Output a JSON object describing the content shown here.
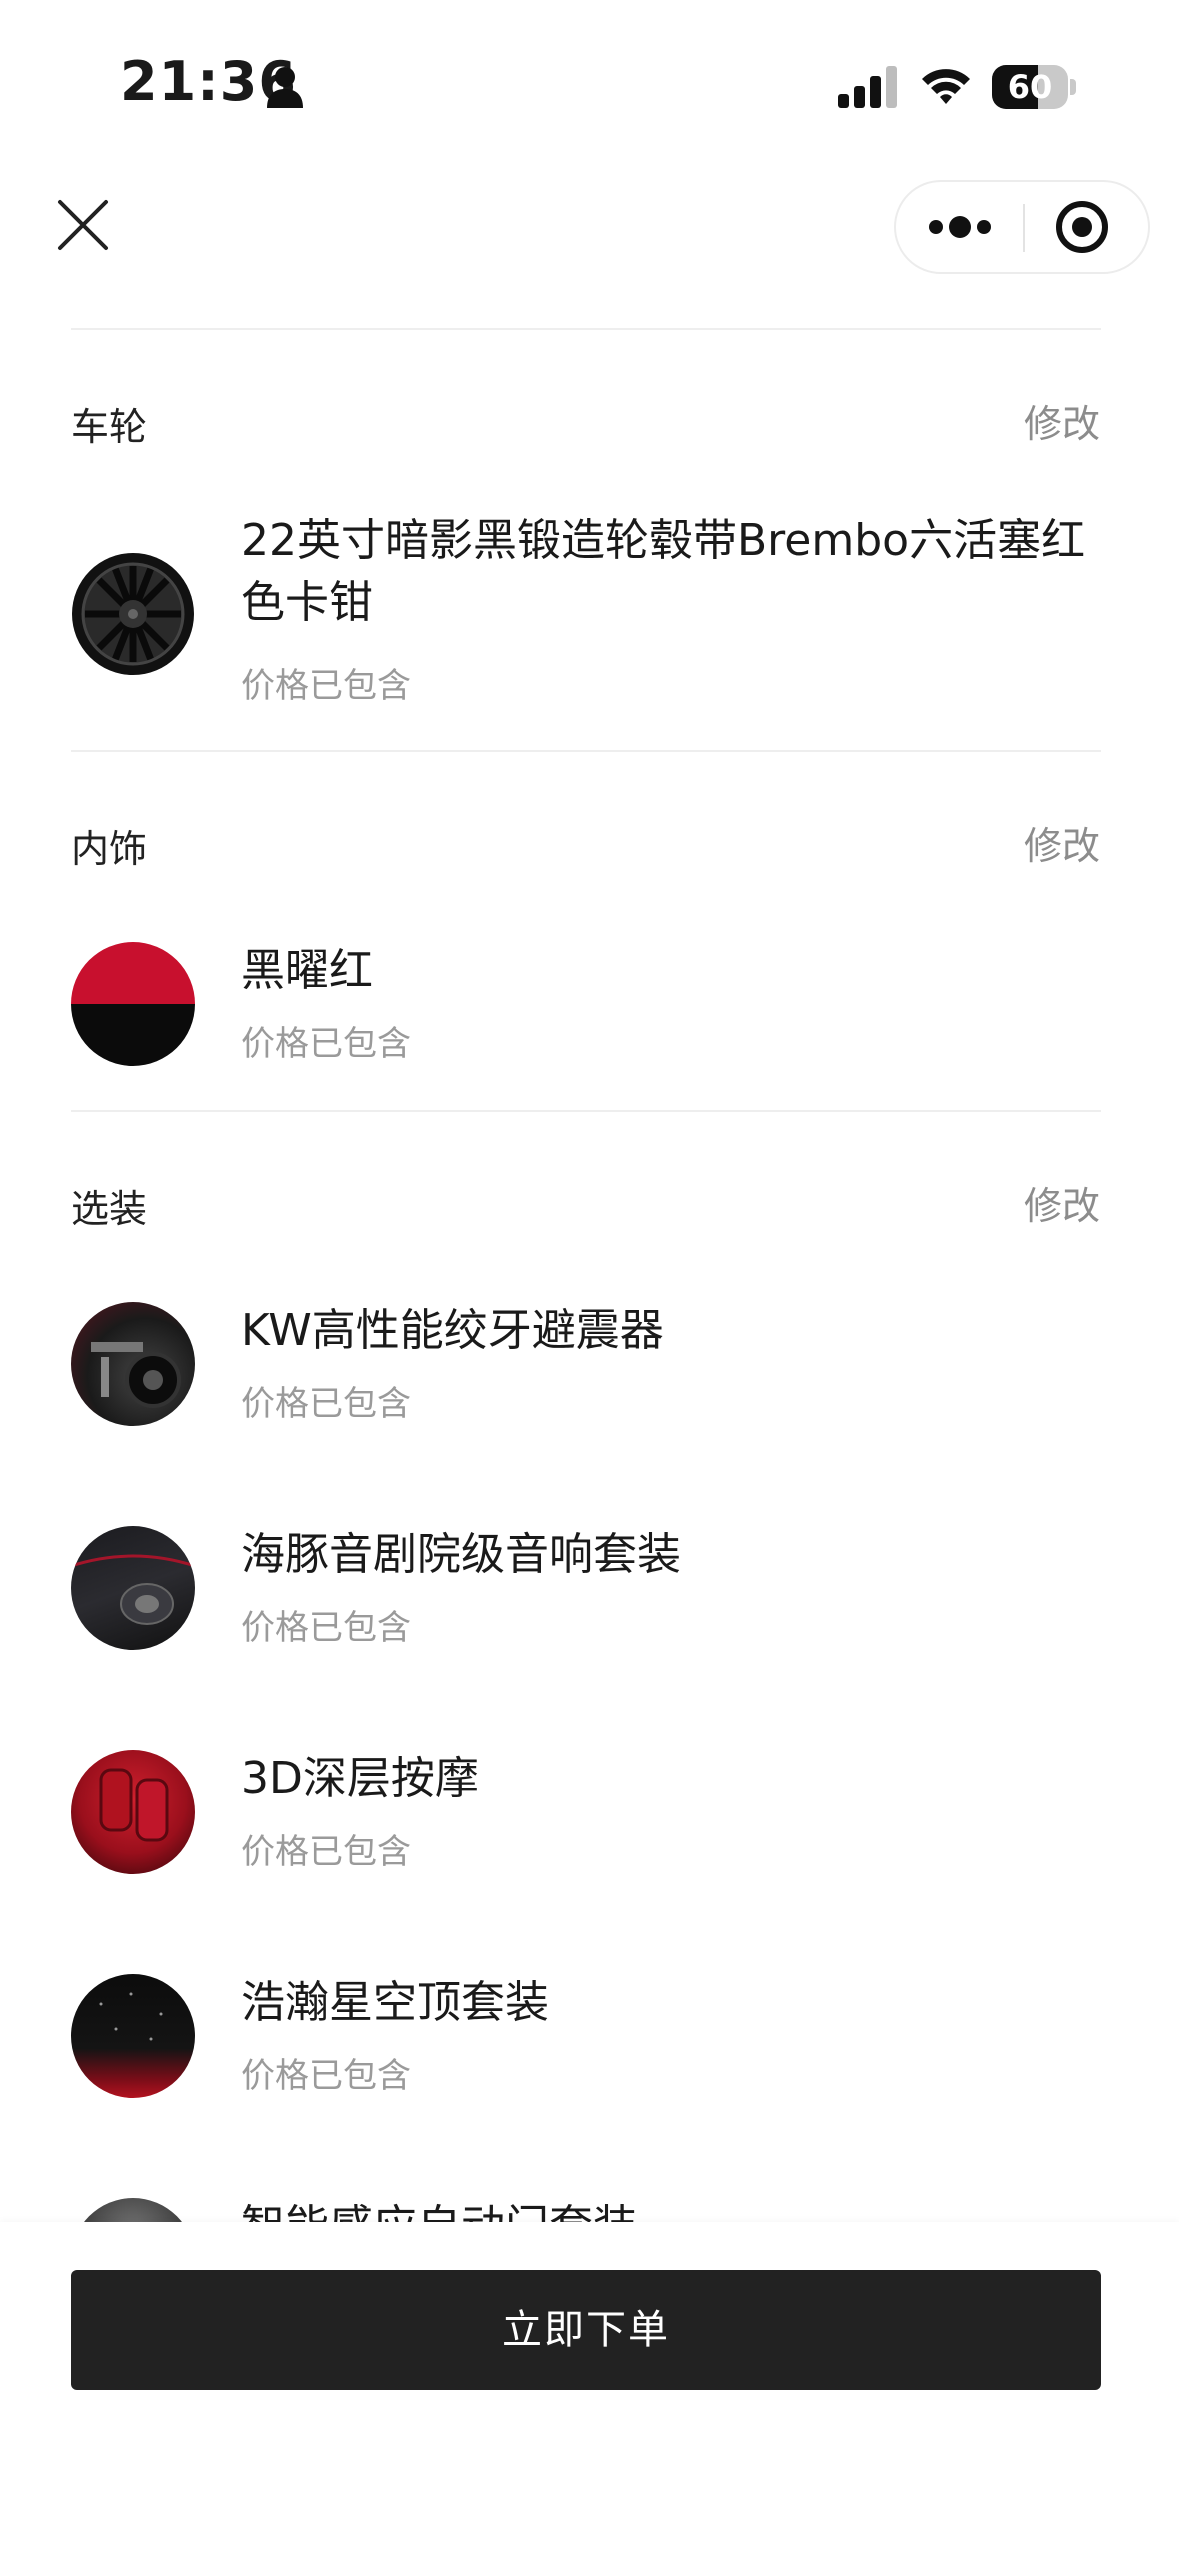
{
  "status_bar": {
    "time": "21:36",
    "battery": "60",
    "battery_level": 0.6
  },
  "nav": {
    "icons": [
      "close-icon",
      "more-dots-icon",
      "target-icon"
    ]
  },
  "sections": {
    "wheels": {
      "title": "车轮",
      "edit": "修改",
      "item": {
        "name": "22英寸暗影黑锻造轮毂带Brembo六活塞红色卡钳",
        "note": "价格已包含"
      }
    },
    "interior": {
      "title": "内饰",
      "edit": "修改",
      "item": {
        "name": "黑曜红",
        "note": "价格已包含"
      }
    },
    "options": {
      "title": "选装",
      "edit": "修改",
      "items": [
        {
          "name": "KW高性能绞牙避震器",
          "note": "价格已包含"
        },
        {
          "name": "海豚音剧院级音响套装",
          "note": "价格已包含"
        },
        {
          "name": "3D深层按摩",
          "note": "价格已包含"
        },
        {
          "name": "浩瀚星空顶套装",
          "note": "价格已包含"
        },
        {
          "name": "智能感应自动门套装",
          "note": ""
        }
      ]
    }
  },
  "footer": {
    "order_button": "立即下单"
  }
}
